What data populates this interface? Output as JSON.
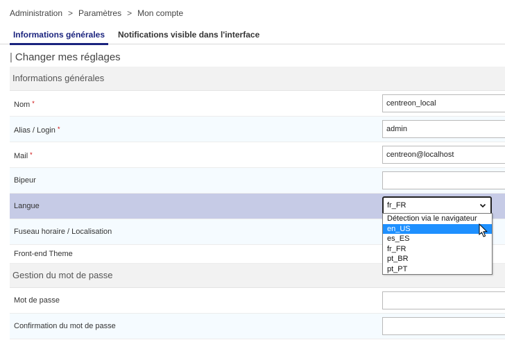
{
  "breadcrumb": {
    "items": [
      "Administration",
      "Paramètres",
      "Mon compte"
    ],
    "separator": ">"
  },
  "tabs": [
    {
      "label": "Informations générales",
      "active": true
    },
    {
      "label": "Notifications visible dans l'interface",
      "active": false
    }
  ],
  "page_heading": {
    "bar": "|",
    "title": "Changer mes réglages"
  },
  "groups": {
    "general": "Informations générales",
    "password": "Gestion du mot de passe"
  },
  "fields": {
    "nom": {
      "label": "Nom",
      "required_mark": "*",
      "value": "centreon_local"
    },
    "alias": {
      "label": "Alias / Login",
      "required_mark": "*",
      "value": "admin"
    },
    "mail": {
      "label": "Mail",
      "required_mark": "*",
      "value": "centreon@localhost"
    },
    "bipeur": {
      "label": "Bipeur",
      "value": ""
    },
    "langue": {
      "label": "Langue",
      "value": "fr_FR",
      "chevron": "⌄"
    },
    "fuseau": {
      "label": "Fuseau horaire / Localisation"
    },
    "theme": {
      "label": "Front-end Theme"
    },
    "password": {
      "label": "Mot de passe",
      "value": ""
    },
    "password_confirm": {
      "label": "Confirmation du mot de passe",
      "value": ""
    }
  },
  "langue_dropdown": {
    "options": [
      "Détection via le navigateur",
      "en_US",
      "es_ES",
      "fr_FR",
      "pt_BR",
      "pt_PT"
    ],
    "highlighted": "en_US"
  },
  "colors": {
    "active_tab": "#1a237e",
    "highlight_row": "#c6cbe6",
    "required": "#cc0000",
    "option_highlight": "#1e90ff"
  }
}
